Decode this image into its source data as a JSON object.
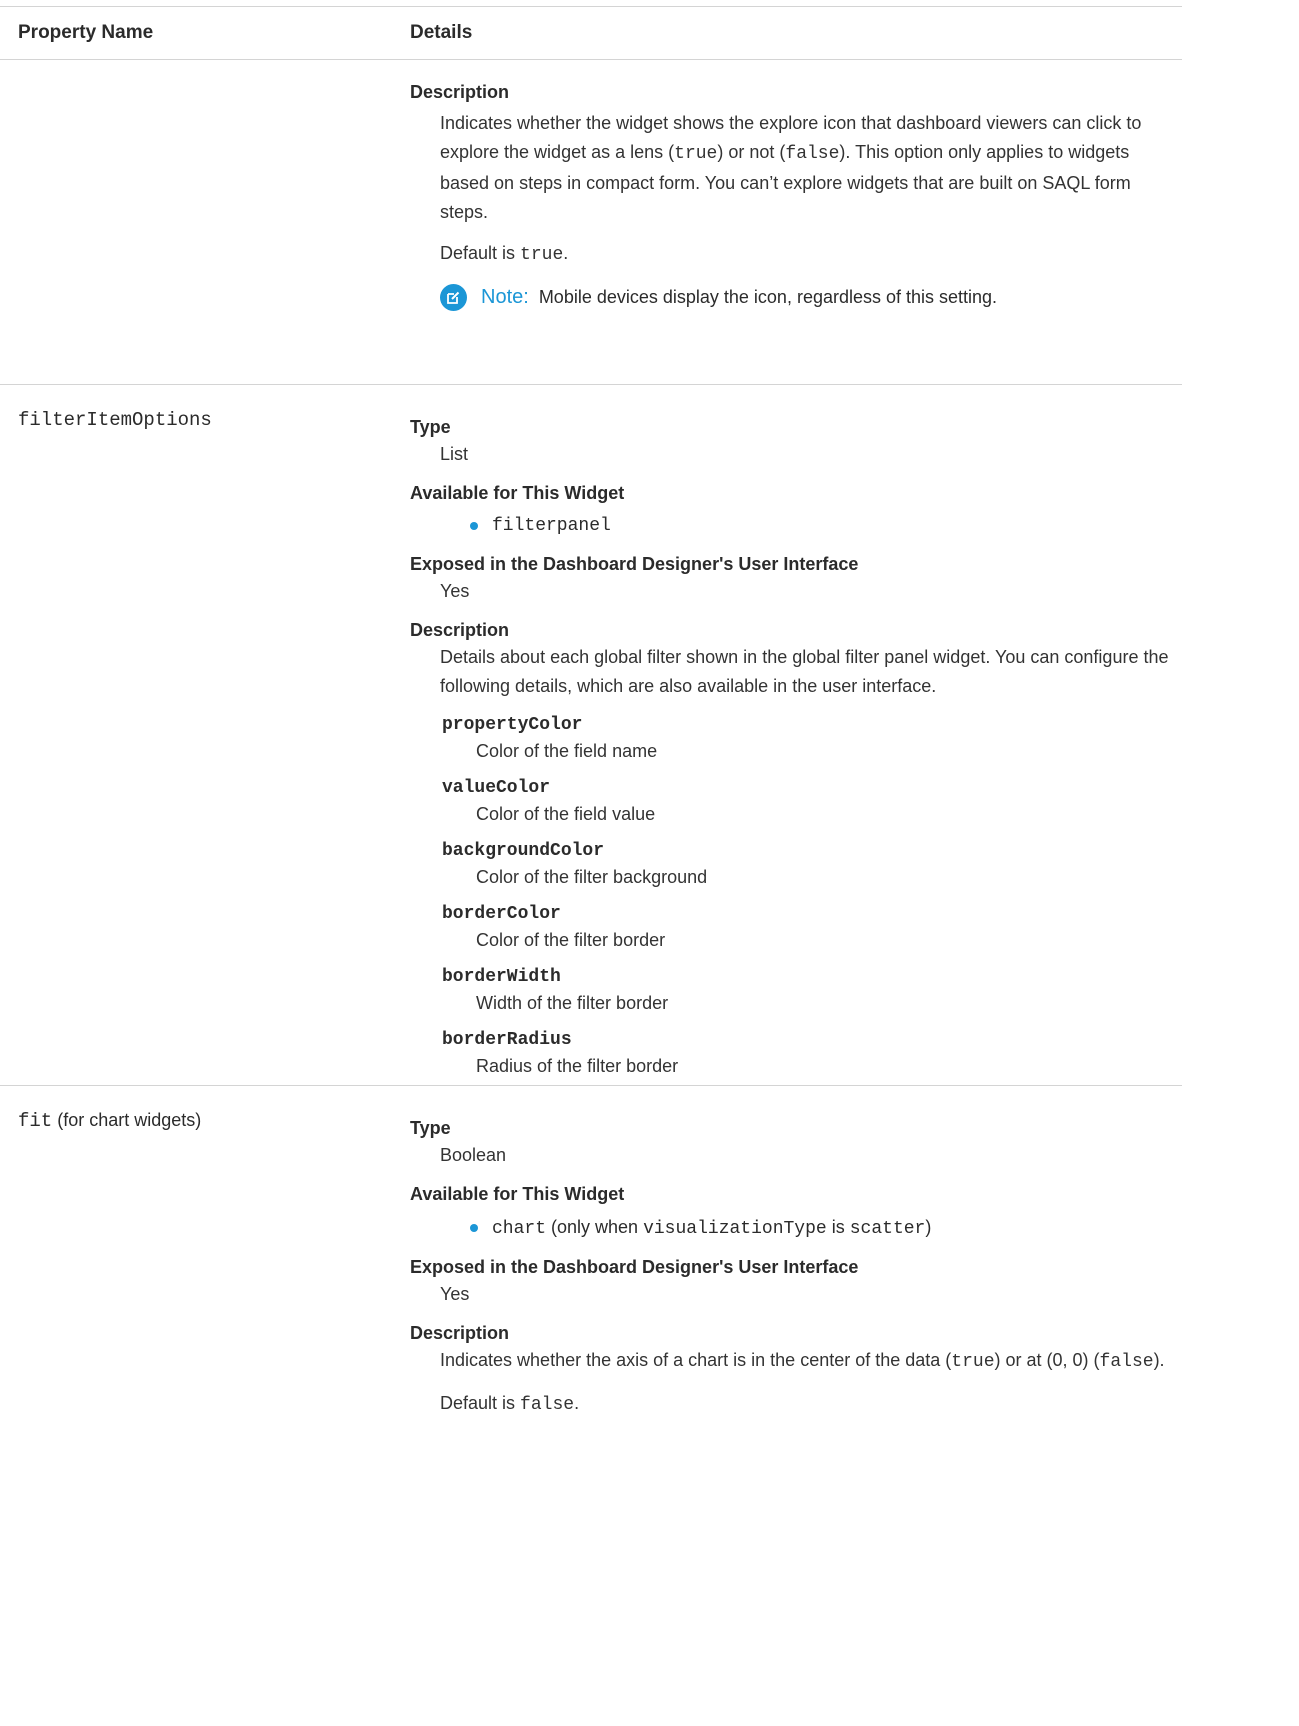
{
  "header": {
    "col1": "Property Name",
    "col2": "Details"
  },
  "row_explore": {
    "description_label": "Description",
    "description_parts": [
      "Indicates whether the widget shows the explore icon that dashboard viewers can click to explore the widget as a lens (",
      "true",
      ") or not (",
      "false",
      "). This option only applies to widgets based on steps in compact form. You can’t explore widgets that are built on SAQL form steps."
    ],
    "default_prefix": "Default is ",
    "default_value": "true",
    "default_suffix": ".",
    "note_label": "Note:",
    "note_text": "Mobile devices display the icon, regardless of this setting."
  },
  "row_filter": {
    "name": "filterItemOptions",
    "type_label": "Type",
    "type_value": "List",
    "available_label": "Available for This Widget",
    "available_item": "filterpanel",
    "exposed_label": "Exposed in the Dashboard Designer's User Interface",
    "exposed_value": "Yes",
    "description_label": "Description",
    "description_text": "Details about each global filter shown in the global filter panel widget. You can configure the following details, which are also available in the user interface.",
    "items": [
      {
        "term": "propertyColor",
        "def": "Color of the field name"
      },
      {
        "term": "valueColor",
        "def": "Color of the field value"
      },
      {
        "term": "backgroundColor",
        "def": "Color of the filter background"
      },
      {
        "term": "borderColor",
        "def": "Color of the filter border"
      },
      {
        "term": "borderWidth",
        "def": "Width of the filter border"
      },
      {
        "term": "borderRadius",
        "def": "Radius of the filter border"
      }
    ]
  },
  "row_fit": {
    "name": "fit",
    "name_suffix": " (for chart widgets)",
    "type_label": "Type",
    "type_value": "Boolean",
    "available_label": "Available for This Widget",
    "available_parts": [
      "chart",
      " (only when ",
      "visualizationType",
      " is ",
      "scatter",
      ")"
    ],
    "exposed_label": "Exposed in the Dashboard Designer's User Interface",
    "exposed_value": "Yes",
    "description_label": "Description",
    "description_parts": [
      "Indicates whether the axis of a chart is in the center of the data (",
      "true",
      ") or at (0, 0) (",
      "false",
      ")."
    ],
    "default_prefix": "Default is ",
    "default_value": "false",
    "default_suffix": "."
  },
  "colors": {
    "accent": "#1b96d6",
    "border": "#d4d4d4"
  }
}
